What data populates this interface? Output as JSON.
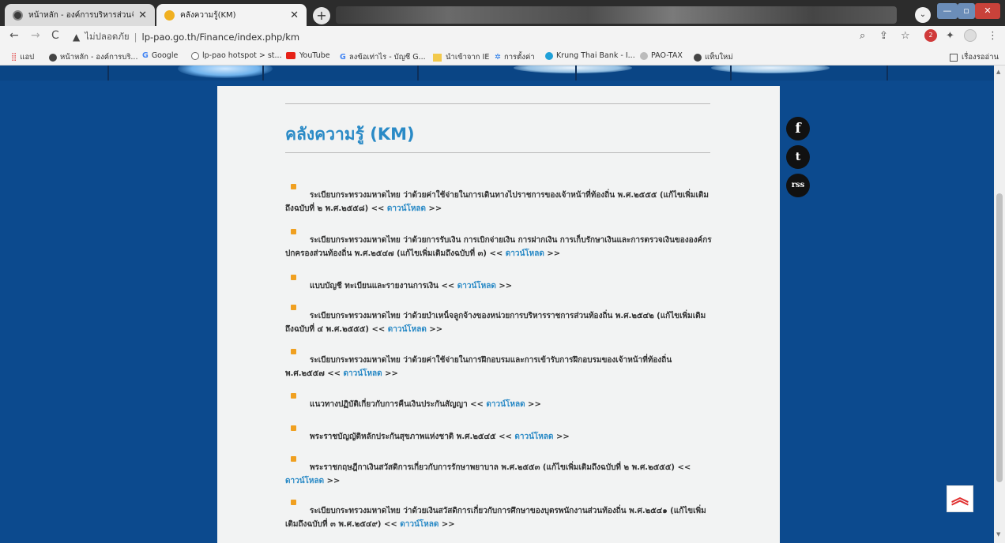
{
  "browser": {
    "tabs": [
      {
        "title": "หน้าหลัก - องค์การบริหารส่วนจังหวัด",
        "active": false
      },
      {
        "title": "คลังความรู้(KM)",
        "active": true
      }
    ],
    "new_tab_label": "+",
    "address": {
      "security_label": "ไม่ปลอดภัย",
      "url": "lp-pao.go.th/Finance/index.php/km"
    },
    "bookmarks": [
      {
        "label": "แอป",
        "icon": "apps-grid-icon",
        "color": "#e04040"
      },
      {
        "label": "หน้าหลัก - องค์การบริ...",
        "icon": "site-icon",
        "color": "#444444"
      },
      {
        "label": "Google",
        "icon": "google-icon",
        "color": "#4285f4"
      },
      {
        "label": "lp-pao hotspot > st...",
        "icon": "site-icon",
        "color": "#666666"
      },
      {
        "label": "YouTube",
        "icon": "youtube-icon",
        "color": "#e62117"
      },
      {
        "label": "ลงข้อเท่าไร - บัญชี G...",
        "icon": "google-icon",
        "color": "#4285f4"
      },
      {
        "label": "นำเข้าจาก IE",
        "icon": "folder-icon",
        "color": "#f2c94c"
      },
      {
        "label": "การตั้งค่า",
        "icon": "gear-icon",
        "color": "#1a73e8"
      },
      {
        "label": "Krung Thai Bank - I...",
        "icon": "bank-icon",
        "color": "#1fa0d8"
      },
      {
        "label": "PAO-TAX",
        "icon": "globe-icon",
        "color": "#888888"
      },
      {
        "label": "แท็บใหม่",
        "icon": "chrome-icon",
        "color": "#444444"
      }
    ],
    "reading_list_label": "เรื่องรออ่าน",
    "extension_badge": "2"
  },
  "page": {
    "title": "คลังความรู้ (KM)",
    "download_label": "ดาวน์โหลด",
    "documents": [
      {
        "text": "ระเบียบกระทรวงมหาดไทย ว่าด้วยค่าใช้จ่ายในการเดินทางไปราชการของเจ้าหน้าที่ท้องถิ่น พ.ศ.๒๕๕๕ (แก้ไขเพิ่มเติมถึงฉบับที่ ๒ พ.ศ.๒๕๕๘)"
      },
      {
        "text": "ระเบียบกระทรวงมหาดไทย ว่าด้วยการรับเงิน การเบิกจ่ายเงิน การฝากเงิน การเก็บรักษาเงินและการตรวจเงินขององค์กรปกครองส่วนท้องถิ่น พ.ศ.๒๕๔๗ (แก้ไขเพิ่มเติมถึงฉบับที่ ๓)"
      },
      {
        "text": "แบบบัญชี ทะเบียนและรายงานการเงิน"
      },
      {
        "text": "ระเบียบกระทรวงมหาดไทย ว่าด้วยบำเหน็จลูกจ้างของหน่วยการบริหารราชการส่วนท้องถิ่น พ.ศ.๒๕๔๒ (แก้ไขเพิ่มเติมถึงฉบับที่ ๔ พ.ศ.๒๕๕๕)"
      },
      {
        "text": "ระเบียบกระทรวงมหาดไทย ว่าด้วยค่าใช้จ่ายในการฝึกอบรมและการเข้ารับการฝึกอบรมของเจ้าหน้าที่ท้องถิ่น พ.ศ.๒๕๕๗"
      },
      {
        "text": "แนวทางปฏิบัติเกี่ยวกับการคืนเงินประกันสัญญา"
      },
      {
        "text": "พระราชบัญญัติหลักประกันสุขภาพแห่งชาติ พ.ศ.๒๕๔๕"
      },
      {
        "text": "พระราชกฤษฎีกาเงินสวัสดิการเกี่ยวกับการรักษาพยาบาล พ.ศ.๒๕๕๓ (แก้ไขเพิ่มเติมถึงฉบับที่ ๒ พ.ศ.๒๕๕๕)"
      },
      {
        "text": "ระเบียบกระทรวงมหาดไทย ว่าด้วยเงินสวัสดิการเกี่ยวกับการศึกษาของบุตรพนักงานส่วนท้องถิ่น พ.ศ.๒๕๔๑ (แก้ไขเพิ่มเติมถึงฉบับที่ ๓ พ.ศ.๒๕๔๙)"
      }
    ],
    "social": [
      {
        "label": "f",
        "icon": "facebook-icon"
      },
      {
        "label": "t",
        "icon": "twitter-icon"
      },
      {
        "label": "rss",
        "icon": "rss-icon"
      }
    ],
    "back_to_top_label": "︽"
  }
}
